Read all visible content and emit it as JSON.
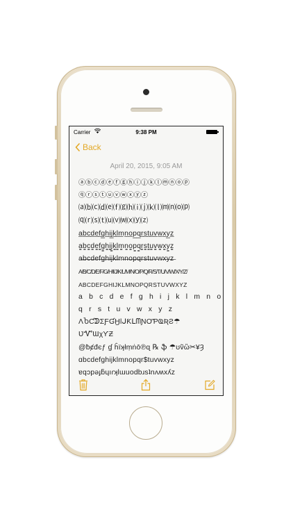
{
  "status_bar": {
    "carrier": "Carrier",
    "time": "9:38 PM"
  },
  "nav": {
    "back_label": "Back"
  },
  "note": {
    "date": "April 20, 2015, 9:05 AM",
    "lines": [
      "ⓐⓑⓒⓓⓔⓕⓖⓗⓘⓙⓚⓛⓜⓝⓞⓟ",
      "ⓠⓡⓢⓣⓤⓥⓦⓧⓨⓩ",
      "⒜⒝⒞⒟⒠⒡⒢⒣⒤⒥⒦⒧⒨⒩⒪⒫",
      "⒬⒭⒮⒯⒰⒱⒲⒳⒴⒵",
      "a̲b̲c̲d̲e̲f̲g̲h̲i̲j̲k̲l̲m̲n̲o̲p̲q̲r̲s̲t̲u̲v̲w̲x̲y̲z̲",
      "a̳b̳c̳d̳e̳f̳g̳h̳i̳j̳k̳l̳m̳n̳o̳p̳q̳r̳s̳t̳u̳v̳w̳x̳y̳z̳",
      "a̶b̶c̶d̶e̶f̶g̶h̶i̶j̶k̶l̶m̶n̶o̶p̶q̶r̶s̶t̶u̶v̶w̶x̶y̶z̶",
      "A̸B̸C̸D̸E̸F̸G̸H̸I̸J̸K̸L̸M̸N̸O̸P̸Q̸R̸S̸T̸U̸V̸W̸X̸Y̸Z̸",
      "ABCDEFGHIJKLMNOPQRSTUVWXYZ",
      "a b c d e f g h i j k l m n o p",
      "q r s t u v w x y z",
      "ΛႦƇᕲΣƑƓӇƖᒍƘᒪᗰƝƠƤҨƦƧ☂",
      "ƲᏉƜχϒƵ",
      "@ƀȼđєƒ ɠ ĥïʞłṃṅō℗ɋ ℞ ֆ ☂ʊṽὣ✂¥Ȝ",
      "ɑbcdefghijklmnopqr$tuvwxyz",
      "ɐqɔpǝɟƃɥıɾʞlɯuodbɹsʇnʌʍxʎz"
    ]
  },
  "icons": {
    "accent_color": "#e3a825",
    "trash": "trash-icon",
    "share": "share-icon",
    "compose": "compose-icon",
    "back": "chevron-left-icon"
  }
}
